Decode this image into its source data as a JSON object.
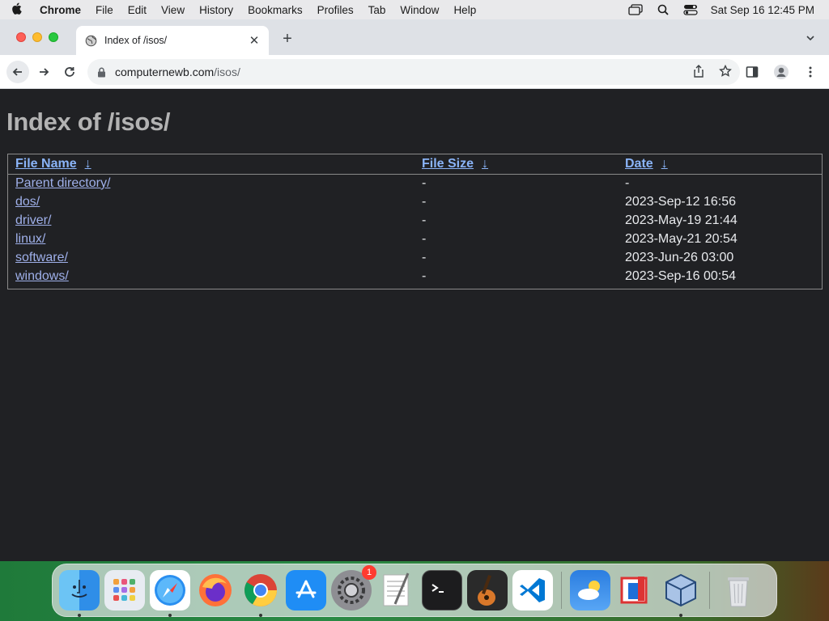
{
  "menubar": {
    "app_name": "Chrome",
    "menus": [
      "File",
      "Edit",
      "View",
      "History",
      "Bookmarks",
      "Profiles",
      "Tab",
      "Window",
      "Help"
    ],
    "datetime": "Sat Sep 16  12:45 PM"
  },
  "tab": {
    "title": "Index of /isos/",
    "close_symbol": "✕",
    "new_tab_symbol": "+"
  },
  "address_bar": {
    "host": "computernewb.com",
    "path": "/isos/"
  },
  "page": {
    "title": "Index of /isos/",
    "columns": [
      {
        "label": "File Name",
        "sort_symbol": "↓"
      },
      {
        "label": "File Size",
        "sort_symbol": "↓"
      },
      {
        "label": "Date",
        "sort_symbol": "↓"
      }
    ],
    "rows": [
      {
        "name": "Parent directory/",
        "size": "-",
        "date": "-"
      },
      {
        "name": "dos/",
        "size": "-",
        "date": "2023-Sep-12 16:56"
      },
      {
        "name": "driver/",
        "size": "-",
        "date": "2023-May-19 21:44"
      },
      {
        "name": "linux/",
        "size": "-",
        "date": "2023-May-21 20:54"
      },
      {
        "name": "software/",
        "size": "-",
        "date": "2023-Jun-26 03:00"
      },
      {
        "name": "windows/",
        "size": "-",
        "date": "2023-Sep-16 00:54"
      }
    ]
  },
  "dock": {
    "items": [
      "finder-icon",
      "launchpad-icon",
      "safari-icon",
      "firefox-icon",
      "chrome-icon",
      "app-store-icon",
      "system-settings-icon",
      "textedit-icon",
      "terminal-icon",
      "garageband-icon",
      "vscode-icon",
      "weather-icon",
      "parallels-icon",
      "virtualbox-icon",
      "trash-icon"
    ],
    "settings_badge": "1"
  },
  "colors": {
    "page_bg": "#202124",
    "link": "#8ab4f8",
    "title": "#b3b3b3"
  }
}
